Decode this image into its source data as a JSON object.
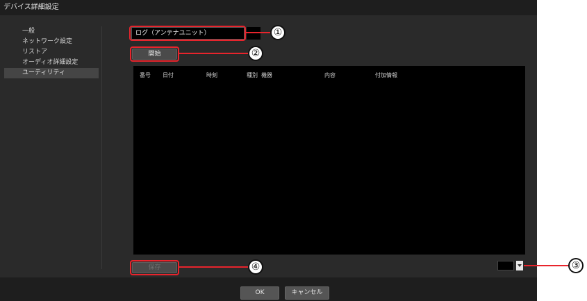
{
  "window": {
    "title": "デバイス詳細設定"
  },
  "sidebar": {
    "items": [
      {
        "label": "一般"
      },
      {
        "label": "ネットワーク設定"
      },
      {
        "label": "リストア"
      },
      {
        "label": "オーディオ詳細設定"
      },
      {
        "label": "ユーティリティ"
      }
    ],
    "active_index": 4
  },
  "utility": {
    "log_type": "ログ（アンテナユニット）",
    "start_label": "開始",
    "save_label": "保存",
    "table": {
      "columns": [
        "番号",
        "日付",
        "時刻",
        "種別",
        "機器",
        "内容",
        "付加情報"
      ],
      "rows": []
    }
  },
  "footer": {
    "ok_label": "OK",
    "cancel_label": "キャンセル"
  },
  "callouts": [
    "①",
    "②",
    "③",
    "④"
  ],
  "colors": {
    "highlight": "#e8242c",
    "background": "#2a2a2a",
    "table": "#000000"
  }
}
